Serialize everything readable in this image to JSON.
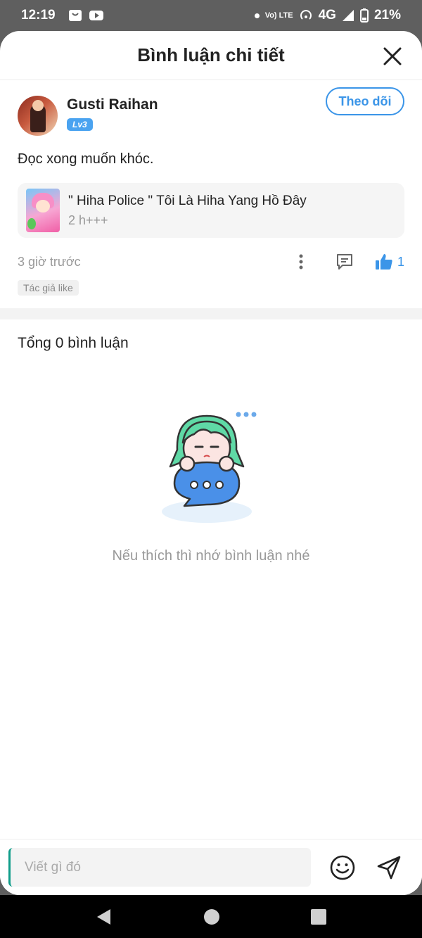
{
  "status_bar": {
    "time": "12:19",
    "network_small": "Vo) LTE",
    "network": "4G",
    "battery": "21%"
  },
  "header": {
    "title": "Bình luận chi tiết"
  },
  "comment": {
    "username": "Gusti Raihan",
    "level": "Lv3",
    "follow_label": "Theo dõi",
    "text": "Đọc xong muốn khóc.",
    "book": {
      "title": "\" Hiha Police \" Tôi Là Hiha Yang Hồ Đây",
      "subtitle": "2 h+++"
    },
    "time_ago": "3 giờ trước",
    "like_count": "1",
    "author_like_tag": "Tác giả like"
  },
  "replies": {
    "total_label": "Tổng 0 bình luận",
    "empty_message": "Nếu thích thì nhớ bình luận nhé"
  },
  "input": {
    "placeholder": "Viết gì đó"
  },
  "colors": {
    "accent": "#3b95e8",
    "mascot_hair": "#5fd9a6",
    "bubble": "#4a90e8"
  }
}
